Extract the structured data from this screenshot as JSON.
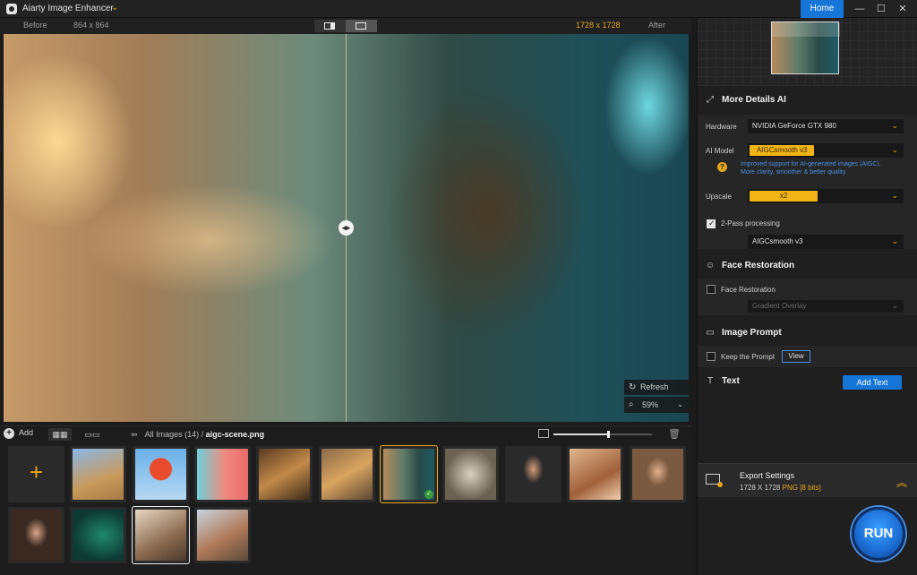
{
  "titlebar": {
    "app_title": "Aiarty Image Enhancer",
    "home_label": "Home",
    "min_glyph": "—",
    "max_glyph": "☐",
    "close_glyph": "✕"
  },
  "compare": {
    "before_label": "Before",
    "before_size": "864 x 864",
    "after_size": "1728 x 1728",
    "after_label": "After"
  },
  "canvas": {
    "refresh_label": "Refresh",
    "zoom_value": "59%"
  },
  "strip": {
    "add_label": "Add",
    "breadcrumb_all": "All Images (14)",
    "breadcrumb_sep": "/",
    "breadcrumb_file": "aigc-scene.png",
    "thumb_size_level": 0.55,
    "thumbnails": [
      {
        "desc": "lion-cub"
      },
      {
        "desc": "hot-air-balloon"
      },
      {
        "desc": "flamingo"
      },
      {
        "desc": "dog"
      },
      {
        "desc": "lion"
      },
      {
        "desc": "aigc-scene",
        "selected": true
      },
      {
        "desc": "butterfly"
      },
      {
        "desc": "man-portrait"
      },
      {
        "desc": "woman-with-dog"
      },
      {
        "desc": "woman-smiling"
      },
      {
        "desc": "woman-laughing"
      },
      {
        "desc": "peacock-feather"
      },
      {
        "desc": "group-photo",
        "current": true
      },
      {
        "desc": "friends-selfie"
      }
    ]
  },
  "panel": {
    "more_details_title": "More Details AI",
    "hardware_label": "Hardware",
    "hardware_value": "NVIDIA GeForce GTX 980",
    "ai_model_label": "AI Model",
    "ai_model_value": "AIGCsmooth  v3",
    "ai_model_hint": "Improved support for AI-generated images (AIGC).\nMore clarity, smoother & better quality.",
    "upscale_label": "Upscale",
    "upscale_value": "x2",
    "two_pass_label": "2-Pass processing",
    "two_pass_model": "AIGCsmooth  v3",
    "face_title": "Face Restoration",
    "face_checkbox_label": "Face Restoration",
    "face_mode_value": "Gradient Overlay",
    "prompt_title": "Image Prompt",
    "keep_prompt_label": "Keep the Prompt",
    "view_label": "View",
    "text_title": "Text",
    "add_text_label": "Add Text",
    "export_title": "Export Settings",
    "export_size": "1728 X 1728",
    "export_format": "PNG",
    "export_bits": "[8 bits]",
    "run_label": "RUN"
  },
  "colors": {
    "accent": "#e4a61c",
    "primary_blue": "#1576d8"
  }
}
